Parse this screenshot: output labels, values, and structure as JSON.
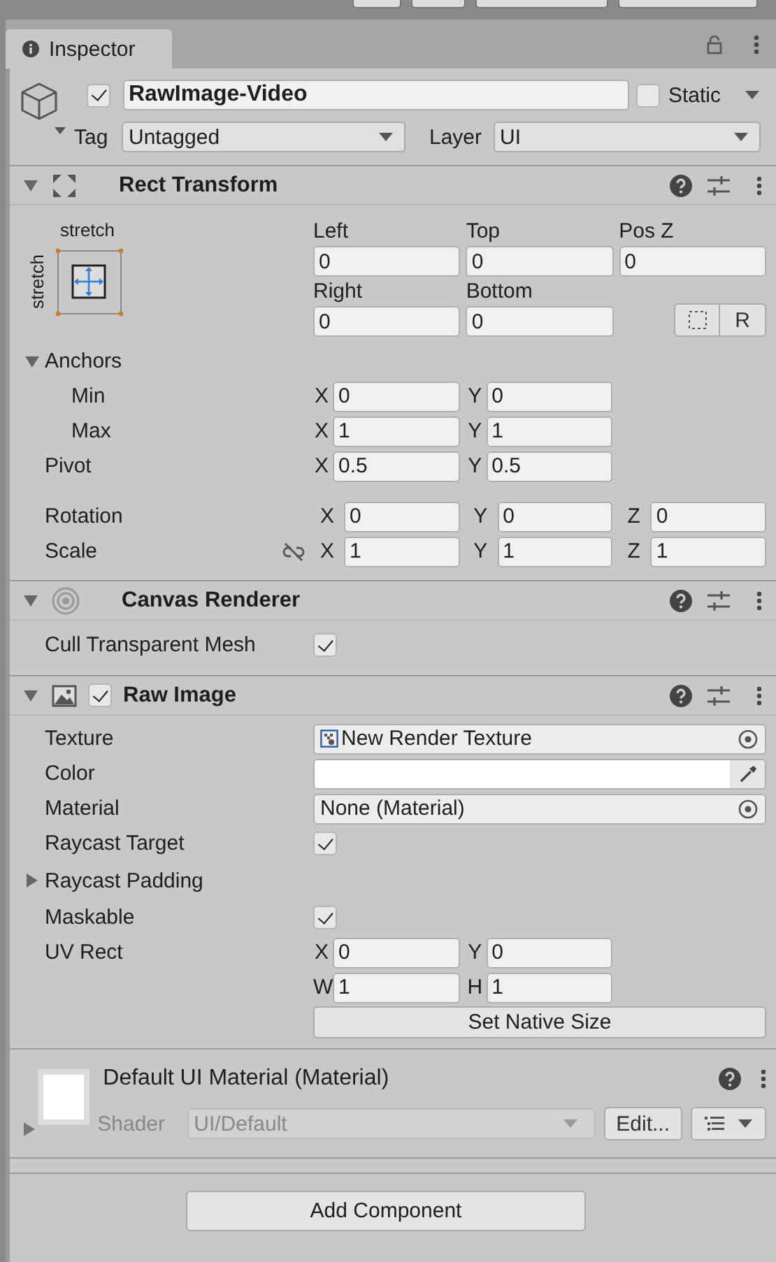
{
  "tab": {
    "title": "Inspector",
    "selected": true
  },
  "object": {
    "active": true,
    "name": "RawImage-Video",
    "static": false,
    "static_label": "Static",
    "tag_label": "Tag",
    "tag": "Untagged",
    "layer_label": "Layer",
    "layer": "UI"
  },
  "rect_transform": {
    "title": "Rect Transform",
    "expanded": true,
    "preset_horizontal": "stretch",
    "preset_vertical": "stretch",
    "offsets": [
      {
        "label": "Left",
        "value": "0"
      },
      {
        "label": "Top",
        "value": "0"
      },
      {
        "label": "Pos Z",
        "value": "0"
      },
      {
        "label": "Right",
        "value": "0"
      },
      {
        "label": "Bottom",
        "value": "0"
      }
    ],
    "raw_button": "R",
    "anchors": {
      "label": "Anchors",
      "expanded": true,
      "children": [
        {
          "label": "Min",
          "fields": [
            {
              "axis": "X",
              "value": "0"
            },
            {
              "axis": "Y",
              "value": "0"
            }
          ]
        },
        {
          "label": "Max",
          "fields": [
            {
              "axis": "X",
              "value": "1"
            },
            {
              "axis": "Y",
              "value": "1"
            }
          ]
        }
      ]
    },
    "pivot": {
      "label": "Pivot",
      "fields": [
        {
          "axis": "X",
          "value": "0.5"
        },
        {
          "axis": "Y",
          "value": "0.5"
        }
      ]
    },
    "rotation": {
      "label": "Rotation",
      "fields": [
        {
          "axis": "X",
          "value": "0"
        },
        {
          "axis": "Y",
          "value": "0"
        },
        {
          "axis": "Z",
          "value": "0"
        }
      ]
    },
    "scale": {
      "label": "Scale",
      "linked": false,
      "fields": [
        {
          "axis": "X",
          "value": "1"
        },
        {
          "axis": "Y",
          "value": "1"
        },
        {
          "axis": "Z",
          "value": "1"
        }
      ]
    }
  },
  "canvas_renderer": {
    "title": "Canvas Renderer",
    "expanded": true,
    "properties": [
      {
        "kind": "checkbox",
        "label": "Cull Transparent Mesh",
        "checked": true
      }
    ]
  },
  "raw_image": {
    "title": "Raw Image",
    "enabled": true,
    "expanded": true,
    "properties": [
      {
        "kind": "asset",
        "label": "Texture",
        "value": "New Render Texture"
      },
      {
        "kind": "color",
        "label": "Color",
        "color": "#ffffff"
      },
      {
        "kind": "object",
        "label": "Material",
        "value": "None (Material)"
      },
      {
        "kind": "checkbox",
        "label": "Raycast Target",
        "checked": true
      },
      {
        "kind": "foldout",
        "label": "Raycast Padding",
        "expanded": false
      },
      {
        "kind": "checkbox",
        "label": "Maskable",
        "checked": true
      },
      {
        "kind": "rect",
        "label": "UV Rect",
        "rows": [
          [
            {
              "axis": "X",
              "value": "0"
            },
            {
              "axis": "Y",
              "value": "0"
            }
          ],
          [
            {
              "axis": "W",
              "value": "1"
            },
            {
              "axis": "H",
              "value": "1"
            }
          ]
        ]
      },
      {
        "kind": "button",
        "label": "Set Native Size"
      }
    ]
  },
  "material": {
    "name": "Default UI Material (Material)",
    "expanded": false,
    "shader_label": "Shader",
    "shader": "UI/Default",
    "shader_disabled": true,
    "edit_button": "Edit..."
  },
  "add_component": "Add Component"
}
